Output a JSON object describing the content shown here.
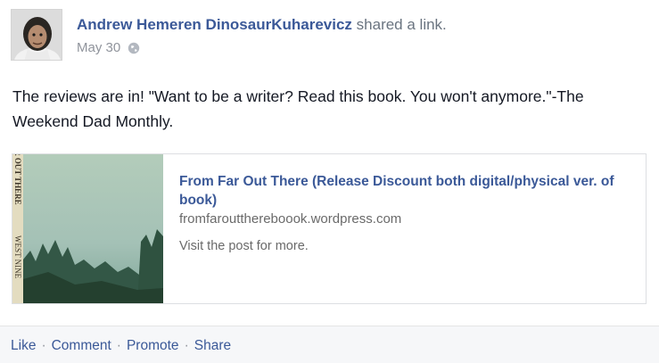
{
  "post": {
    "author": "Andrew Hemeren DinosaurKuharevicz",
    "verb": "shared a link.",
    "date": "May 30",
    "privacy_icon": "globe-icon",
    "text": "The reviews are in! \"Want to be a writer? Read this book. You won't anymore.\"-The Weekend Dad Monthly."
  },
  "link": {
    "title": "From Far Out There (Release Discount both digital/physical ver. of book)",
    "domain": "fromfaroutthereboook.wordpress.com",
    "description": "Visit the post for more.",
    "thumb_text_top": "R OUT THERE",
    "thumb_text_bottom": "WEST NINE"
  },
  "actions": {
    "like": "Like",
    "comment": "Comment",
    "promote": "Promote",
    "share": "Share",
    "separator": "·"
  },
  "colors": {
    "link_blue": "#3b5998",
    "meta_gray": "#90949c",
    "thumb_sky": "#a7c3b4",
    "thumb_trees": "#2b4a3a"
  }
}
